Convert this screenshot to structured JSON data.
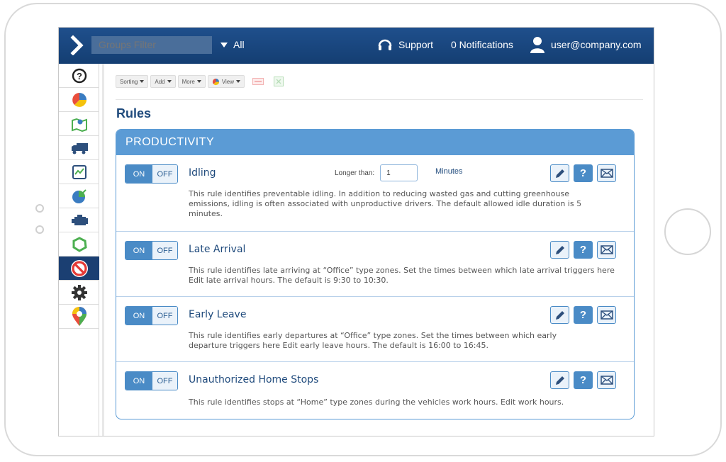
{
  "topbar": {
    "groups_filter_placeholder": "Groups Filter",
    "all_label": "All",
    "support_label": "Support",
    "notifications_label": "0 Notifications",
    "user_label": "user@company.com"
  },
  "sidebar": {
    "items": [
      {
        "icon": "help-icon"
      },
      {
        "icon": "pie-chart-icon"
      },
      {
        "icon": "map-icon"
      },
      {
        "icon": "truck-icon"
      },
      {
        "icon": "line-chart-icon"
      },
      {
        "icon": "exceptions-pie-icon"
      },
      {
        "icon": "engine-icon"
      },
      {
        "icon": "zone-icon"
      },
      {
        "icon": "rules-prohibit-icon",
        "active": true
      },
      {
        "icon": "gear-icon"
      },
      {
        "icon": "marketplace-pin-icon"
      }
    ]
  },
  "toolbar": {
    "sorting": "Sorting",
    "add": "Add",
    "more": "More",
    "view": "View"
  },
  "page": {
    "title": "Rules",
    "section": "PRODUCTIVITY"
  },
  "rules": [
    {
      "on": "ON",
      "off": "OFF",
      "name": "Idling",
      "description": "This rule identifies preventable idling. In addition to reducing wasted gas and cutting greenhouse emissions, idling is often associated with unproductive drivers. The default allowed idle duration is 5 minutes.",
      "longer_than_label": "Longer than:",
      "longer_than_value": "1",
      "unit": "Minutes"
    },
    {
      "on": "ON",
      "off": "OFF",
      "name": "Late Arrival",
      "description": "This rule identifies late arriving at “Office” type zones. Set the times between which late arrival triggers here Edit late arrival hours. The default is 9:30 to 10:30."
    },
    {
      "on": "ON",
      "off": "OFF",
      "name": "Early Leave",
      "description": "This rule identifies early departures at “Office” type zones. Set the times between which early departure triggers here Edit early leave hours. The default is 16:00 to 16:45."
    },
    {
      "on": "ON",
      "off": "OFF",
      "name": "Unauthorized Home Stops",
      "description": "This rule identifies stops at “Home” type zones during the vehicles work hours. Edit work hours."
    }
  ],
  "action_help_label": "?",
  "colors": {
    "topbar": "#1a4780",
    "accent": "#4a8bc6",
    "panel_header": "#5b9bd5",
    "title": "#1f4a7c"
  }
}
